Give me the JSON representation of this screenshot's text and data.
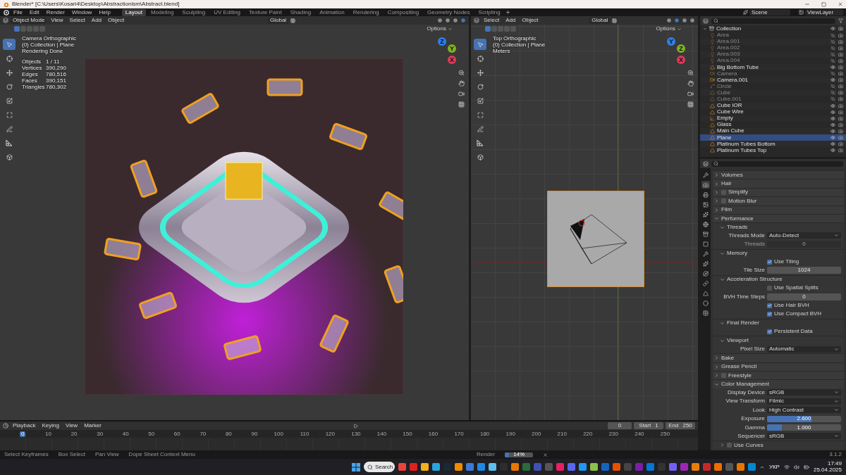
{
  "window": {
    "title": "Blender* [C:\\Users\\Kosari4\\Desktop\\Abstractionism\\Abstract.blend]"
  },
  "menu": [
    "File",
    "Edit",
    "Render",
    "Window",
    "Help"
  ],
  "workspaces": [
    {
      "label": "Layout",
      "selected": true
    },
    {
      "label": "Modeling",
      "selected": false
    },
    {
      "label": "Sculpting",
      "selected": false
    },
    {
      "label": "UV Editing",
      "selected": false
    },
    {
      "label": "Texture Paint",
      "selected": false
    },
    {
      "label": "Shading",
      "selected": false
    },
    {
      "label": "Animation",
      "selected": false
    },
    {
      "label": "Rendering",
      "selected": false
    },
    {
      "label": "Compositing",
      "selected": false
    },
    {
      "label": "Geometry Nodes",
      "selected": false
    },
    {
      "label": "Scripting",
      "selected": false
    }
  ],
  "scene": "Scene",
  "view_layer": "ViewLayer",
  "viewport_left": {
    "mode": "Object Mode",
    "menus": [
      "View",
      "Select",
      "Add",
      "Object"
    ],
    "orientation": "Global",
    "options": "Options",
    "shading": [
      {
        "selected": false
      },
      {
        "selected": false
      },
      {
        "selected": false
      },
      {
        "selected": true
      }
    ],
    "overlay": [
      "Camera Orthographic",
      "(0) Collection | Plane",
      "Rendering Done"
    ],
    "stats": [
      {
        "label": "Objects",
        "value": "1 / 11"
      },
      {
        "label": "Vertices",
        "value": "390,290"
      },
      {
        "label": "Edges",
        "value": "780,516"
      },
      {
        "label": "Faces",
        "value": "390,151"
      },
      {
        "label": "Triangles",
        "value": "780,302"
      }
    ],
    "gizmo": [
      "Z",
      "Y",
      "X"
    ],
    "tools": [
      {
        "kind": "select",
        "selected": true
      },
      {
        "kind": "cursor",
        "selected": false
      },
      {
        "kind": "move",
        "selected": false
      },
      {
        "kind": "rotate",
        "selected": false
      },
      {
        "kind": "scale",
        "selected": false
      },
      {
        "kind": "transform",
        "selected": false
      },
      {
        "kind": "annotate",
        "selected": false
      },
      {
        "kind": "measure",
        "selected": false
      },
      {
        "kind": "add",
        "selected": false
      }
    ]
  },
  "viewport_right": {
    "menus": [
      "Select",
      "Add",
      "Object"
    ],
    "orientation": "Global",
    "options": "Options",
    "shading": [
      {
        "selected": false
      },
      {
        "selected": true
      },
      {
        "selected": false
      },
      {
        "selected": false
      }
    ],
    "overlay": [
      "Top Orthographic",
      "(0) Collection | Plane",
      "Meters"
    ],
    "gizmo": [
      "Y",
      "Z",
      "X"
    ],
    "tools": [
      {
        "kind": "select",
        "selected": true
      },
      {
        "kind": "cursor",
        "selected": false
      },
      {
        "kind": "move",
        "selected": false
      },
      {
        "kind": "rotate",
        "selected": false
      },
      {
        "kind": "scale",
        "selected": false
      },
      {
        "kind": "transform",
        "selected": false
      },
      {
        "kind": "annotate",
        "selected": false
      },
      {
        "kind": "measure",
        "selected": false
      },
      {
        "kind": "add",
        "selected": false
      }
    ]
  },
  "outliner": {
    "collection": {
      "name": "Collection",
      "expanded": true,
      "children": [
        {
          "name": "Area",
          "kind": "light",
          "hidden": true,
          "selected": false
        },
        {
          "name": "Area.001",
          "kind": "light",
          "hidden": true,
          "selected": false
        },
        {
          "name": "Area.002",
          "kind": "light",
          "hidden": true,
          "selected": false
        },
        {
          "name": "Area.003",
          "kind": "light",
          "hidden": true,
          "selected": false
        },
        {
          "name": "Area.004",
          "kind": "light",
          "hidden": true,
          "selected": false
        },
        {
          "name": "Big Bottom Tube",
          "kind": "mesh",
          "hidden": false,
          "selected": false
        },
        {
          "name": "Camera",
          "kind": "camera",
          "hidden": true,
          "selected": false
        },
        {
          "name": "Camera.001",
          "kind": "camera",
          "hidden": false,
          "selected": false
        },
        {
          "name": "Circle",
          "kind": "curve",
          "hidden": true,
          "selected": false
        },
        {
          "name": "Cube",
          "kind": "mesh",
          "hidden": true,
          "selected": false
        },
        {
          "name": "Cube.001",
          "kind": "mesh",
          "hidden": true,
          "selected": false
        },
        {
          "name": "Cube IOR",
          "kind": "mesh",
          "hidden": false,
          "selected": false
        },
        {
          "name": "Cube Wire",
          "kind": "mesh",
          "hidden": false,
          "selected": false
        },
        {
          "name": "Empty",
          "kind": "empty",
          "hidden": false,
          "selected": false
        },
        {
          "name": "Glass",
          "kind": "mesh",
          "hidden": false,
          "selected": false
        },
        {
          "name": "Main Cube",
          "kind": "mesh",
          "hidden": false,
          "selected": false
        },
        {
          "name": "Plane",
          "kind": "mesh",
          "hidden": false,
          "selected": true
        },
        {
          "name": "Platinum Tubes Bottom",
          "kind": "mesh",
          "hidden": false,
          "selected": false
        },
        {
          "name": "Platinum Tubes Top",
          "kind": "mesh",
          "hidden": false,
          "selected": false
        }
      ]
    }
  },
  "properties_tabs": [
    {
      "kind": "tool",
      "selected": false
    },
    {
      "kind": "render",
      "selected": true
    },
    {
      "kind": "output",
      "selected": false
    },
    {
      "kind": "view",
      "selected": false
    },
    {
      "kind": "scene",
      "selected": false
    },
    {
      "kind": "world",
      "selected": false
    },
    {
      "kind": "collection",
      "selected": false
    },
    {
      "kind": "object",
      "selected": false
    },
    {
      "kind": "modifier",
      "selected": false
    },
    {
      "kind": "particles",
      "selected": false
    },
    {
      "kind": "physics",
      "selected": false
    },
    {
      "kind": "constraints",
      "selected": false
    },
    {
      "kind": "data",
      "selected": false
    },
    {
      "kind": "material",
      "selected": false
    },
    {
      "kind": "texture",
      "selected": false
    }
  ],
  "properties": [
    {
      "kind": "panel",
      "label": "Volumes",
      "expanded": false
    },
    {
      "kind": "panel",
      "label": "Hair",
      "expanded": false
    },
    {
      "kind": "panel",
      "label": "Simplify",
      "expanded": false,
      "checked": false
    },
    {
      "kind": "panel",
      "label": "Motion Blur",
      "expanded": false,
      "checked": false
    },
    {
      "kind": "panel",
      "label": "Film",
      "expanded": false
    },
    {
      "kind": "panel",
      "label": "Performance",
      "expanded": true
    },
    {
      "kind": "subpanel",
      "label": "Threads",
      "expanded": true
    },
    {
      "kind": "dropdown",
      "label": "Threads Mode",
      "value": "Auto-Detect"
    },
    {
      "kind": "number",
      "label": "Threads",
      "value": "0",
      "disabled": true
    },
    {
      "kind": "subpanel",
      "label": "Memory",
      "expanded": true
    },
    {
      "kind": "checkbox",
      "label": "Use Tiling",
      "checked": true
    },
    {
      "kind": "number",
      "label": "Tile Size",
      "value": "1024",
      "disabled": false
    },
    {
      "kind": "subpanel",
      "label": "Acceleration Structure",
      "expanded": true
    },
    {
      "kind": "checkbox",
      "label": "Use Spatial Splits",
      "checked": false
    },
    {
      "kind": "number",
      "label": "BVH Time Steps",
      "value": "0",
      "disabled": false
    },
    {
      "kind": "checkbox",
      "label": "Use Hair BVH",
      "checked": true
    },
    {
      "kind": "checkbox",
      "label": "Use Compact BVH",
      "checked": true
    },
    {
      "kind": "subpanel",
      "label": "Final Render",
      "expanded": true
    },
    {
      "kind": "checkbox",
      "label": "Persistent Data",
      "checked": true
    },
    {
      "kind": "subpanel",
      "label": "Viewport",
      "expanded": true
    },
    {
      "kind": "dropdown",
      "label": "Pixel Size",
      "value": "Automatic"
    },
    {
      "kind": "panel",
      "label": "Bake",
      "expanded": false
    },
    {
      "kind": "panel",
      "label": "Grease Pencil",
      "expanded": false
    },
    {
      "kind": "panel",
      "label": "Freestyle",
      "expanded": false,
      "checked": false
    },
    {
      "kind": "panel",
      "label": "Color Management",
      "expanded": true
    },
    {
      "kind": "dropdown",
      "label": "Display Device",
      "value": "sRGB"
    },
    {
      "kind": "dropdown",
      "label": "View Transform",
      "value": "Filmic"
    },
    {
      "kind": "dropdown",
      "label": "Look",
      "value": "High Contrast"
    },
    {
      "kind": "slider",
      "label": "Exposure",
      "value": "2.600",
      "level": 0.6
    },
    {
      "kind": "slider",
      "label": "Gamma",
      "value": "1.000",
      "level": 0.2
    },
    {
      "kind": "dropdown",
      "label": "Sequencer",
      "value": "sRGB"
    },
    {
      "kind": "subpanel",
      "label": "Use Curves",
      "expanded": false,
      "checked": false
    }
  ],
  "timeline": {
    "menus": [
      "Playback",
      "Keying",
      "View",
      "Marker"
    ],
    "frame": "0",
    "start_label": "Start",
    "start": "1",
    "end_label": "End",
    "end": "250",
    "playhead": "0",
    "ticks": [
      "10",
      "20",
      "30",
      "40",
      "50",
      "60",
      "70",
      "80",
      "90",
      "100",
      "110",
      "120",
      "130",
      "140",
      "150",
      "160",
      "170",
      "180",
      "190",
      "200",
      "210",
      "220",
      "230",
      "240",
      "250"
    ]
  },
  "status_bar": {
    "hints": [
      "Select Keyframes",
      "Box Select",
      "Pan View",
      "Dope Sheet Context Menu"
    ],
    "render_label": "Render",
    "render_progress": "14%",
    "level": 0.14,
    "version": "3.1.2"
  },
  "taskbar": {
    "search": "Search",
    "language": "УКР",
    "time": "17:49",
    "date": "25.04.2025",
    "apps": [
      {
        "color": "#e8443a"
      },
      {
        "color": "#e02020"
      },
      {
        "color": "#f2b01e"
      },
      {
        "color": "#2aa3e0"
      },
      {
        "color": "#1b2838"
      },
      {
        "color": "#f08a00"
      },
      {
        "color": "#3a7bd5"
      },
      {
        "color": "#1e88e5"
      },
      {
        "color": "#5bc0eb"
      },
      {
        "color": "#2d2d2d"
      },
      {
        "color": "#ea7600"
      },
      {
        "color": "#2a6b3c"
      },
      {
        "color": "#3f51b5"
      },
      {
        "color": "#555555"
      },
      {
        "color": "#e91e63"
      },
      {
        "color": "#5865f2"
      },
      {
        "color": "#2196f3"
      },
      {
        "color": "#8bc34a"
      },
      {
        "color": "#1565c0"
      },
      {
        "color": "#e65100"
      },
      {
        "color": "#444444"
      },
      {
        "color": "#7b1fa2"
      },
      {
        "color": "#0078d4"
      },
      {
        "color": "#333333"
      },
      {
        "color": "#7360f2"
      },
      {
        "color": "#9c27b0"
      },
      {
        "color": "#e87d0d"
      },
      {
        "color": "#c62828"
      },
      {
        "color": "#ef6c00"
      },
      {
        "color": "#555555"
      },
      {
        "color": "#ea7600"
      },
      {
        "color": "#0288d1"
      }
    ]
  }
}
